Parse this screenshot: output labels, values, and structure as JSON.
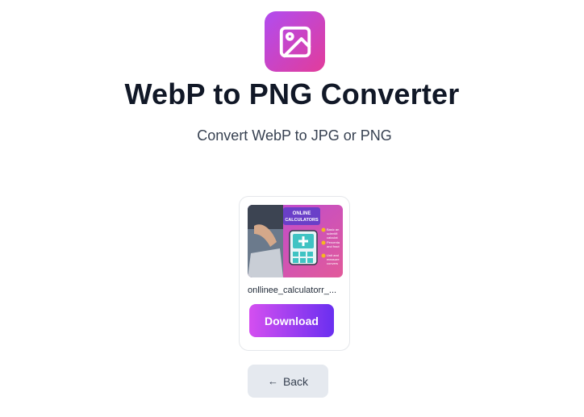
{
  "header": {
    "title": "WebP to PNG Converter",
    "subtitle": "Convert WebP to JPG or PNG",
    "logo_icon": "image-icon",
    "logo_gradient": [
      "#b14cf0",
      "#e23c9a"
    ]
  },
  "result": {
    "filename": "onllinee_calculatorr_...",
    "download_label": "Download",
    "thumbnail": {
      "heading_line1": "ONLINE",
      "heading_line2": "CALCULATORS",
      "bullets": [
        "Basic an",
        "scientifi",
        "calculat",
        "Percenta",
        "and fract",
        "Unit and",
        "measure",
        "convers"
      ]
    }
  },
  "nav": {
    "back_label": "Back",
    "back_icon": "arrow-left-icon"
  },
  "colors": {
    "download_gradient": [
      "#d44ff0",
      "#6a2ff0"
    ],
    "back_bg": "#e5e9ef",
    "title": "#111827"
  }
}
